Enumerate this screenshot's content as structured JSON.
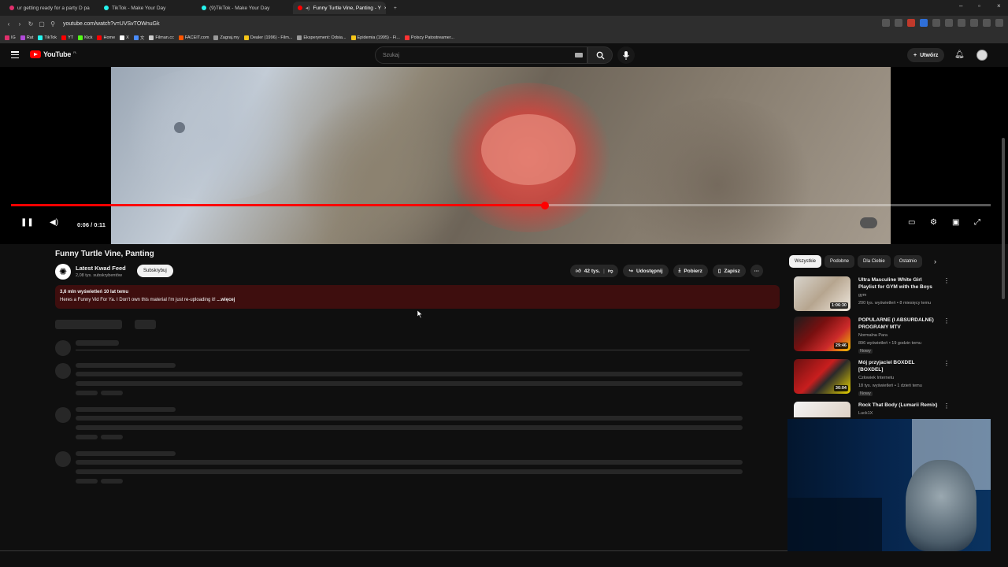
{
  "browser": {
    "tabs": [
      {
        "label": "ur getting ready for a party D pa",
        "color": "#e1306c"
      },
      {
        "label": "TikTok - Make Your Day",
        "color": "#25f4ee"
      },
      {
        "label": "(9)TikTok - Make Your Day",
        "color": "#25f4ee"
      },
      {
        "label": "Funny Turtle Vine, Panting - Y",
        "color": "#ff0000"
      }
    ],
    "new_tab": "+",
    "url": "youtube.com/watch?v=UVSvTOWnuGk",
    "bookmarks": [
      {
        "label": "IG",
        "color": "#e1306c"
      },
      {
        "label": "Rat",
        "color": "#b04ad8"
      },
      {
        "label": "TikTok",
        "color": "#25f4ee"
      },
      {
        "label": "YT",
        "color": "#ff0000"
      },
      {
        "label": "Kick",
        "color": "#53fc18"
      },
      {
        "label": "Home",
        "color": "#ff0000"
      },
      {
        "label": "X",
        "color": "#ffffff"
      },
      {
        "label": "文",
        "color": "#4a8cff"
      },
      {
        "label": "Filman.cc",
        "color": "#cccccc"
      },
      {
        "label": "FACEIT.com",
        "color": "#ff5500"
      },
      {
        "label": "Zagraj.my",
        "color": "#999999"
      },
      {
        "label": "Dealer (1996) - Film...",
        "color": "#f5c518"
      },
      {
        "label": "Eksperyment: Odsia...",
        "color": "#999999"
      },
      {
        "label": "Epidemia (1995) - Fi...",
        "color": "#f5c518"
      },
      {
        "label": "Polscy Patostreamer...",
        "color": "#ff3333"
      }
    ]
  },
  "youtube": {
    "logo_text": "YouTube",
    "logo_region": "PL",
    "search_placeholder": "Szukaj",
    "create_label": "Utwórz"
  },
  "player": {
    "time": "0:06 / 0:11",
    "progress": 0.545
  },
  "video": {
    "title": "Funny Turtle Vine, Panting",
    "channel": "Latest Kwad Feed",
    "subscribers": "2,08 tys. subskrybentów",
    "subscribe_label": "Subskrybuj",
    "likes": "42 tys.",
    "share_label": "Udostępnij",
    "download_label": "Pobierz",
    "save_label": "Zapisz",
    "stats": "3,6 mln wyświetleń  10 lat temu",
    "description": "Heres a Funny Vid For Ya. I Don't own this material I'm just re-uploading it!",
    "more_label": "...więcej"
  },
  "sidebar": {
    "chips": [
      "Wszystkie",
      "Podobne",
      "Dla Ciebie",
      "Ostatnio"
    ],
    "recommendations": [
      {
        "title": "Ultra Masculine White Girl Playlist for GYM with the Boys",
        "channel": "gym",
        "meta": "200 tys. wyświetleń • 8 miesięcy temu",
        "duration": "1:06:30",
        "badge": ""
      },
      {
        "title": "POPULARNE (I ABSURDALNE) PROGRAMY MTV",
        "channel": "Normalna Para",
        "meta": "896 wyświetleń • 19 godzin temu",
        "duration": "29:46",
        "badge": "Nowy"
      },
      {
        "title": "Mój przyjaciel BOXDEL [BOXDEL]",
        "channel": "Człowiek Internetu",
        "meta": "18 tys. wyświetleń • 1 dzień temu",
        "duration": "30:04",
        "badge": "Nowy"
      },
      {
        "title": "Rock That Body (Lumarii Remix)",
        "channel": "Luck1X",
        "meta": "",
        "duration": "",
        "badge": ""
      }
    ]
  }
}
